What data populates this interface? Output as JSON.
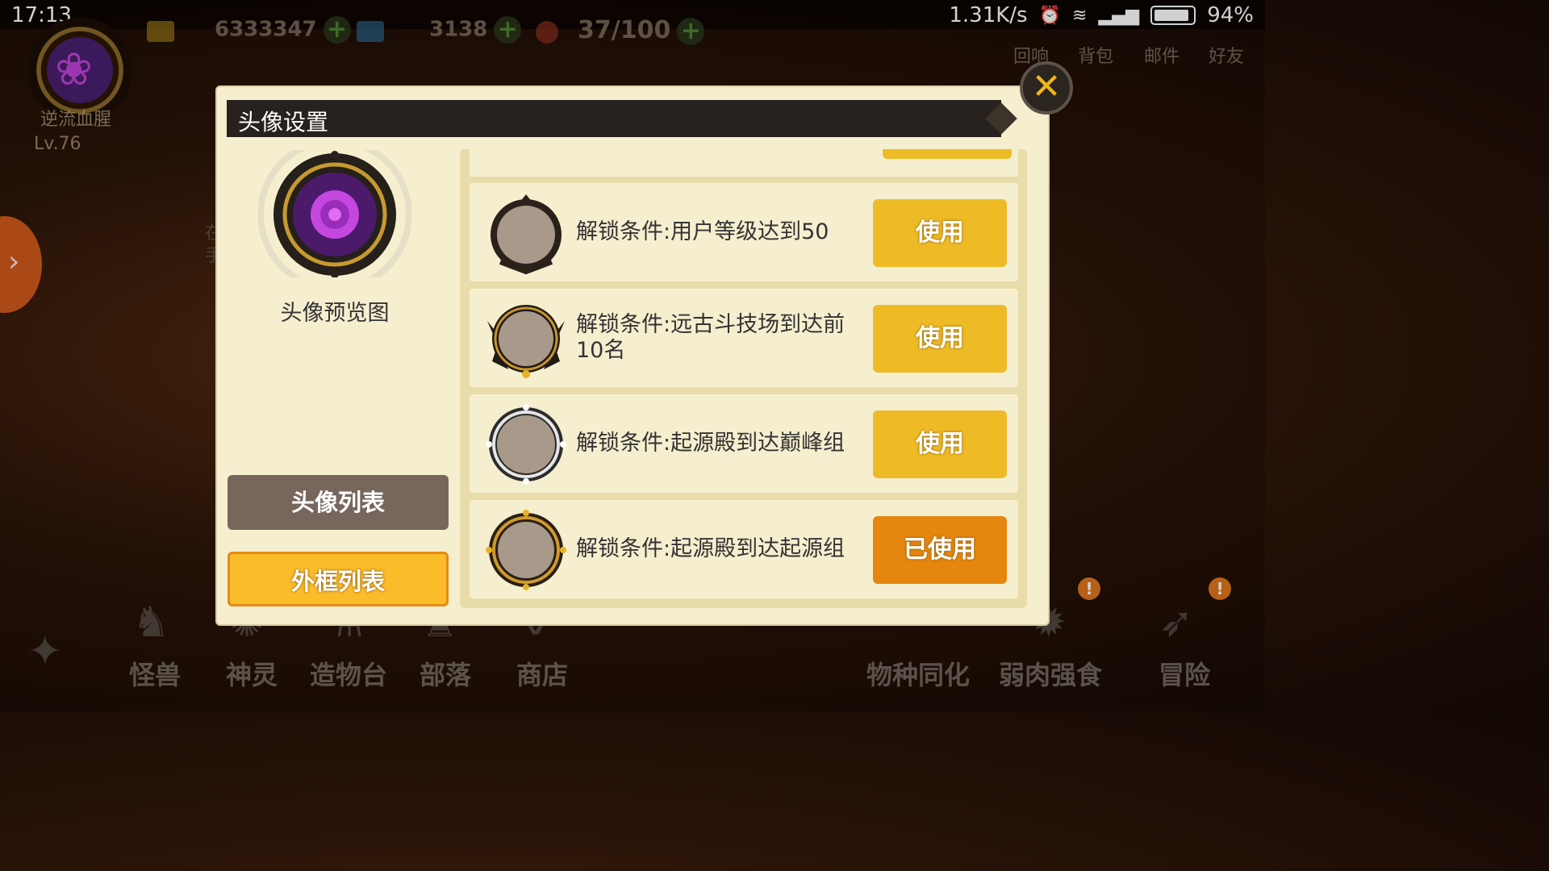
{
  "status_bar": {
    "time": "17:13",
    "network_speed": "1.31K/s",
    "battery": "94%"
  },
  "hud": {
    "player_name": "逆流血腥",
    "level": "Lv.76",
    "gold": "6333347",
    "gems": "3138",
    "stamina": "37/100",
    "menu": [
      "回响",
      "背包",
      "邮件",
      "好友"
    ],
    "side_text": "在手"
  },
  "bottom_nav": {
    "left": [
      "怪兽",
      "神灵",
      "造物台",
      "部落",
      "商店"
    ],
    "right": [
      "物种同化",
      "弱肉强食",
      "冒险"
    ]
  },
  "dialog": {
    "title": "头像设置",
    "preview_caption": "头像预览图",
    "tabs": {
      "avatar_list": "头像列表",
      "frame_list": "外框列表"
    },
    "items": [
      {
        "condition": "解锁条件:用户等级达到50",
        "button": "使用",
        "state": "available",
        "frame_color": "#2a211b"
      },
      {
        "condition": "解锁条件:远古斗技场到达前10名",
        "button": "使用",
        "state": "available",
        "frame_color": "#1f1a16"
      },
      {
        "condition": "解锁条件:起源殿到达巅峰组",
        "button": "使用",
        "state": "available",
        "frame_color": "#2c2c2c"
      },
      {
        "condition": "解锁条件:起源殿到达起源组",
        "button": "已使用",
        "state": "in_use",
        "frame_color": "#2a1f14"
      }
    ]
  },
  "colors": {
    "use_button": "#eebb26",
    "used_button": "#e5860e",
    "dialog_bg": "#f6efcf",
    "title_bar": "#27221d"
  }
}
